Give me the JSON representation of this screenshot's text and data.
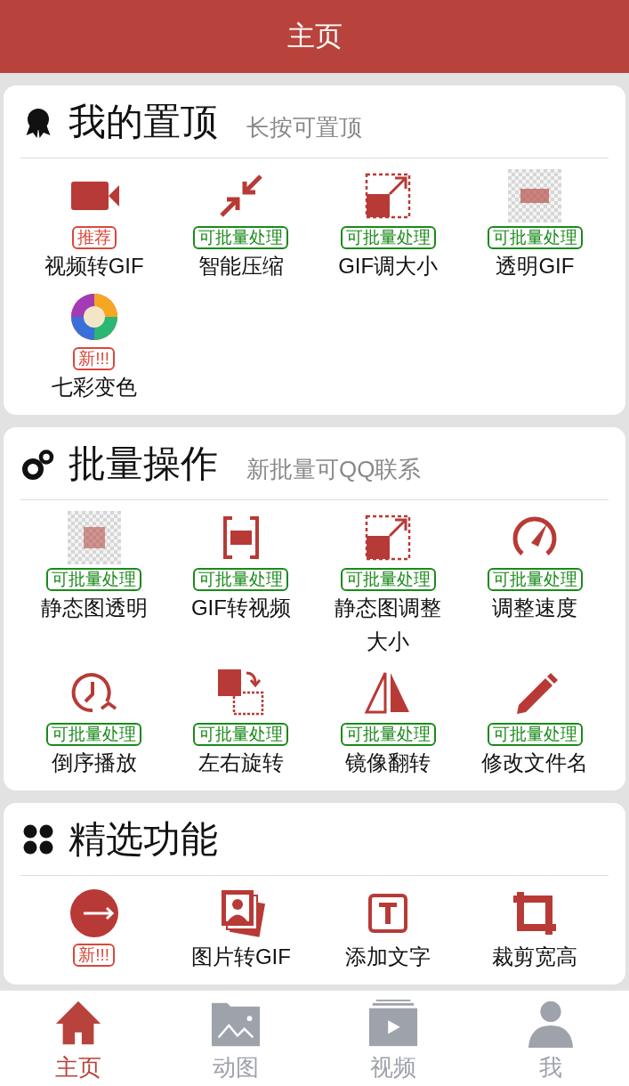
{
  "header": {
    "title": "主页"
  },
  "sections": [
    {
      "title": "我的置顶",
      "subtitle": "长按可置顶",
      "items": [
        {
          "label": "视频转GIF",
          "badge": {
            "text": "推荐",
            "color": "#d9483b"
          }
        },
        {
          "label": "智能压缩",
          "badge": {
            "text": "可批量处理",
            "color": "#1a8a1a"
          }
        },
        {
          "label": "GIF调大小",
          "badge": {
            "text": "可批量处理",
            "color": "#1a8a1a"
          }
        },
        {
          "label": "透明GIF",
          "badge": {
            "text": "可批量处理",
            "color": "#1a8a1a"
          }
        },
        {
          "label": "七彩变色",
          "badge": {
            "text": "新!!!",
            "color": "#d9483b"
          }
        }
      ]
    },
    {
      "title": "批量操作",
      "subtitle": "新批量可QQ联系",
      "items": [
        {
          "label": "静态图透明",
          "badge": {
            "text": "可批量处理",
            "color": "#1a8a1a"
          }
        },
        {
          "label": "GIF转视频",
          "badge": {
            "text": "可批量处理",
            "color": "#1a8a1a"
          }
        },
        {
          "label": "静态图调整大小",
          "badge": {
            "text": "可批量处理",
            "color": "#1a8a1a"
          }
        },
        {
          "label": "调整速度",
          "badge": {
            "text": "可批量处理",
            "color": "#1a8a1a"
          }
        },
        {
          "label": "倒序播放",
          "badge": {
            "text": "可批量处理",
            "color": "#1a8a1a"
          }
        },
        {
          "label": "左右旋转",
          "badge": {
            "text": "可批量处理",
            "color": "#1a8a1a"
          }
        },
        {
          "label": "镜像翻转",
          "badge": {
            "text": "可批量处理",
            "color": "#1a8a1a"
          }
        },
        {
          "label": "修改文件名",
          "badge": {
            "text": "可批量处理",
            "color": "#1a8a1a"
          }
        }
      ]
    },
    {
      "title": "精选功能",
      "items": [
        {
          "badge": {
            "text": "新!!!",
            "color": "#d9483b"
          }
        },
        {
          "label": "图片转GIF"
        },
        {
          "label": "添加文字"
        },
        {
          "label": "裁剪宽高"
        }
      ]
    }
  ],
  "tabs": [
    {
      "label": "主页",
      "selected": true
    },
    {
      "label": "动图",
      "selected": false
    },
    {
      "label": "视频",
      "selected": false
    },
    {
      "label": "我",
      "selected": false
    }
  ]
}
